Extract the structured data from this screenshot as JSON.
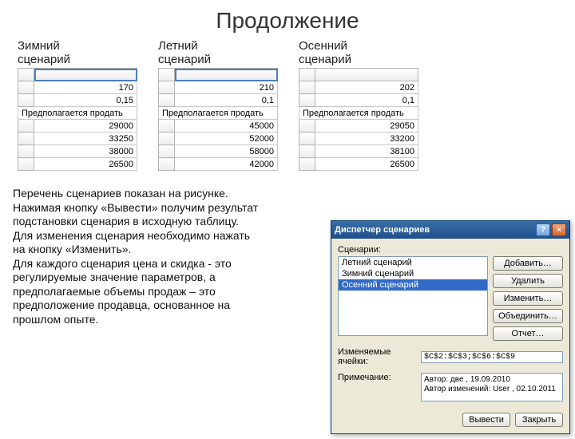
{
  "title": "Продолжение",
  "scenarios": [
    {
      "label": "Зимний\nсценарий",
      "rows": [
        "170",
        "0,15",
        "Предполагается продать",
        "29000",
        "33250",
        "38000",
        "26500"
      ]
    },
    {
      "label": "Летний\nсценарий",
      "rows": [
        "210",
        "0,1",
        "Предполагается продать",
        "45000",
        "52000",
        "58000",
        "42000"
      ]
    },
    {
      "label": "Осенний\nсценарий",
      "rows": [
        "202",
        "0,1",
        "Предполагается продать",
        "29050",
        "33200",
        "38100",
        "26500"
      ]
    }
  ],
  "paragraph": {
    "l1": "Перечень сценариев показан на рисунке.",
    "l2": "Нажимая кнопку «Вывести» получим результат",
    "l3": "подстановки сценария в исходную таблицу.",
    "l4": "Для изменения сценария необходимо нажать",
    "l5": "на кнопку «Изменить».",
    "l6": "Для каждого сценария цена и скидка - это",
    "l7": "регулируемые значение параметров, а",
    "l8": "предполагаемые объемы продаж – это",
    "l9": "предположение продавца, основанное на",
    "l10": "прошлом опыте."
  },
  "dialog": {
    "title": "Диспетчер сценариев",
    "scenarios_label": "Сценарии:",
    "items": [
      "Летний сценарий",
      "Зимний сценарий",
      "Осенний сценарий"
    ],
    "buttons": {
      "add": "Добавить…",
      "delete": "Удалить",
      "edit": "Изменить…",
      "merge": "Объединить…",
      "report": "Отчет…"
    },
    "cells_label": "Изменяемые ячейки:",
    "cells_value": "$C$2:$C$3;$C$6:$C$9",
    "note_label": "Примечание:",
    "note_line1": "Автор: две , 19.09.2010",
    "note_line2": "Автор изменений: User , 02.10.2011",
    "output": "Вывести",
    "close": "Закрыть"
  }
}
